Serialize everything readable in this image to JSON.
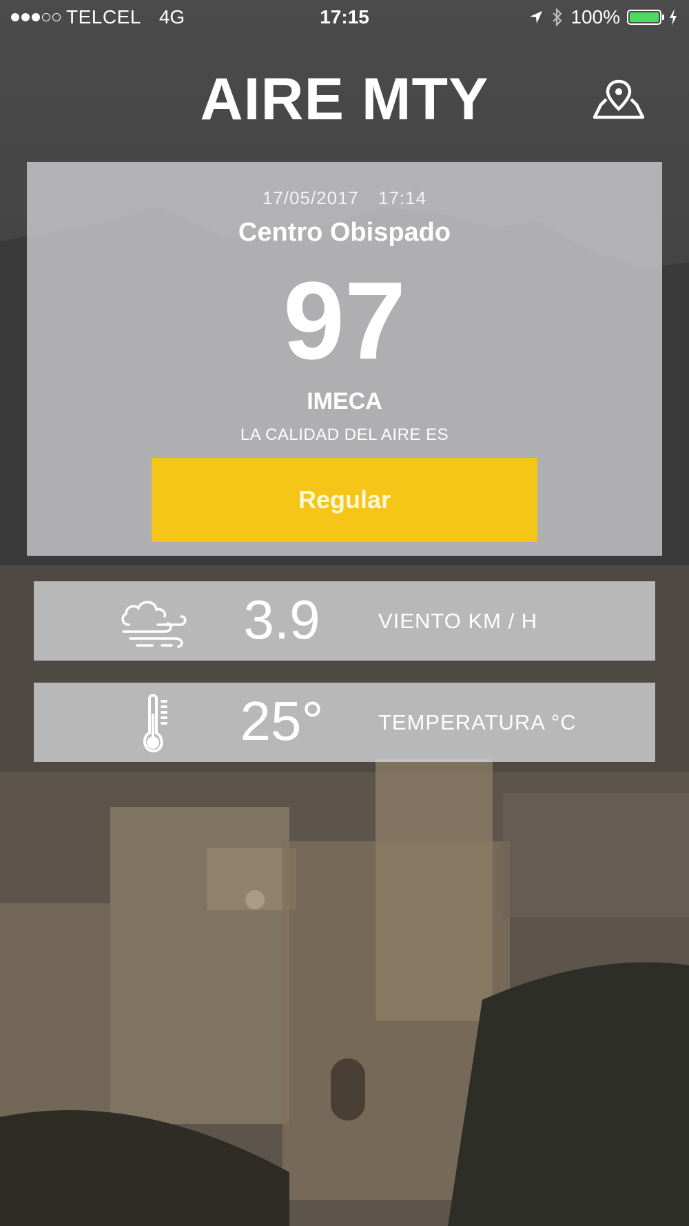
{
  "status_bar": {
    "signal_dots_filled": 3,
    "signal_dots_total": 5,
    "carrier": "TELCEL",
    "network": "4G",
    "time": "17:15",
    "battery": "100%",
    "battery_level": 1.0
  },
  "header": {
    "title": "AIRE MTY",
    "map_icon": "map-pin-icon"
  },
  "reading": {
    "date": "17/05/2017",
    "time": "17:14",
    "station": "Centro Obispado",
    "value": "97",
    "unit": "IMECA",
    "quality_label": "LA CALIDAD DEL AIRE ES",
    "quality": "Regular",
    "quality_color": "#f5c518"
  },
  "weather": [
    {
      "icon": "wind-cloud-icon",
      "value": "3.9",
      "label": "VIENTO  KM  /  H"
    },
    {
      "icon": "thermometer-icon",
      "value": "25°",
      "label": "TEMPERATURA °C"
    }
  ]
}
